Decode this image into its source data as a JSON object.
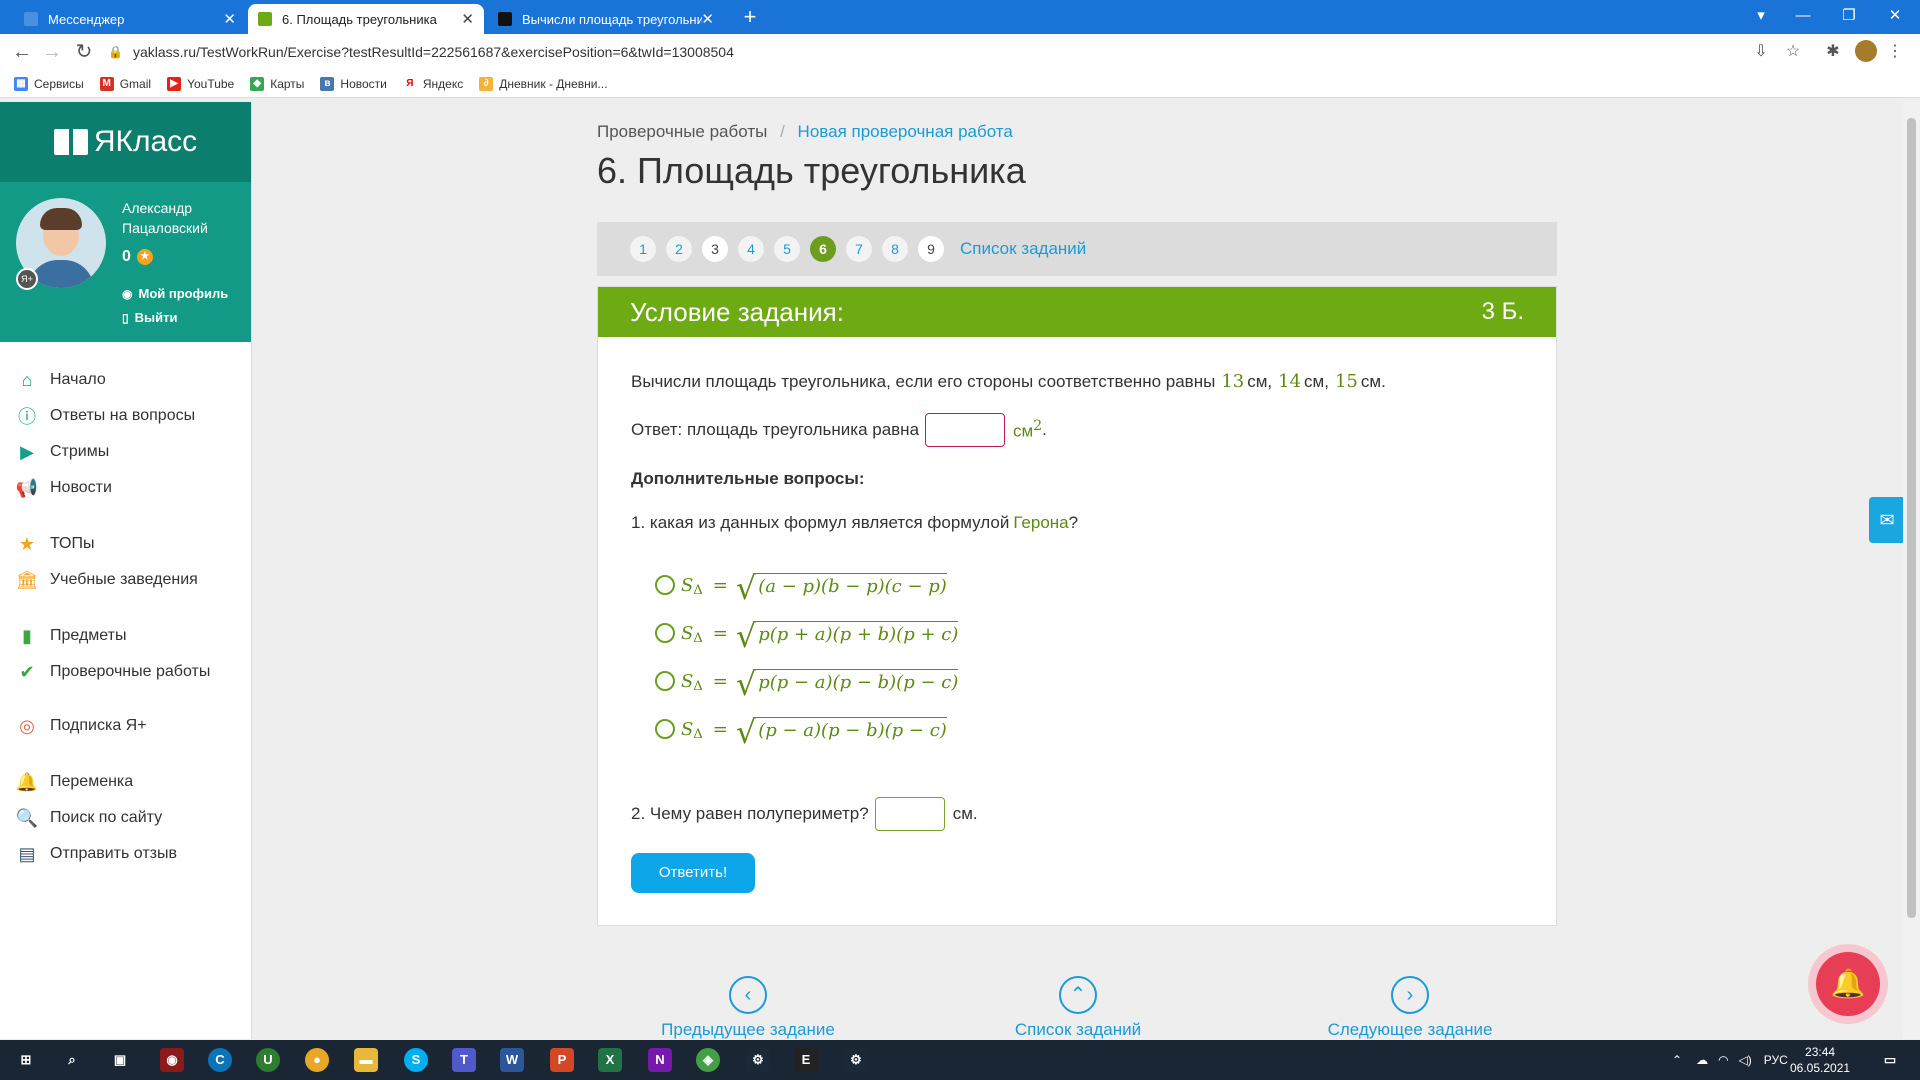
{
  "browser": {
    "tabs": [
      {
        "title": "Мессенджер",
        "close": "✕"
      },
      {
        "title": "6. Площадь треугольника",
        "close": "✕"
      },
      {
        "title": "Вычисли площадь треугольни…",
        "close": "✕"
      }
    ],
    "new_tab": "+",
    "url": "yaklass.ru/TestWorkRun/Exercise?testResultId=222561687&exercisePosition=6&twId=13008504",
    "bookmarks": [
      "Сервисы",
      "Gmail",
      "YouTube",
      "Карты",
      "Новости",
      "Яндекс",
      "Дневник - Дневни..."
    ]
  },
  "sidebar": {
    "logo": "ЯКласс",
    "user_name_line1": "Александр",
    "user_name_line2": "Пацаловский",
    "score": "0",
    "profile_link": "Мой профиль",
    "logout_link": "Выйти",
    "menu": [
      {
        "label": "Начало",
        "icon": "home-icon"
      },
      {
        "label": "Ответы на вопросы",
        "icon": "question-icon"
      },
      {
        "label": "Стримы",
        "icon": "play-icon"
      },
      {
        "label": "Новости",
        "icon": "megaphone-icon"
      },
      {
        "label": "ТОПы",
        "icon": "star-icon"
      },
      {
        "label": "Учебные заведения",
        "icon": "school-icon"
      },
      {
        "label": "Предметы",
        "icon": "books-icon"
      },
      {
        "label": "Проверочные работы",
        "icon": "check-icon"
      },
      {
        "label": "Подписка Я+",
        "icon": "yaplus-icon"
      },
      {
        "label": "Переменка",
        "icon": "bell-icon"
      },
      {
        "label": "Поиск по сайту",
        "icon": "search-icon"
      },
      {
        "label": "Отправить отзыв",
        "icon": "comment-icon"
      }
    ]
  },
  "breadcrumb": {
    "root": "Проверочные работы",
    "separator": "/",
    "current": "Новая проверочная работа"
  },
  "page_title": "6. Площадь треугольника",
  "pager": {
    "pages": [
      "1",
      "2",
      "3",
      "4",
      "5",
      "6",
      "7",
      "8",
      "9"
    ],
    "current": 6,
    "task_list": "Список заданий"
  },
  "task": {
    "header": "Условие задания:",
    "points": "3 Б.",
    "statement_prefix": "Вычисли площадь треугольника, если его стороны соответственно равны",
    "side_a": "13",
    "side_b": "14",
    "side_c": "15",
    "unit_cm": "см",
    "comma": ",",
    "period": ".",
    "answer_label": "Ответ: площадь треугольника равна",
    "answer_unit": "см",
    "answer_unit_power": "2",
    "extra_title": "Дополнительные вопросы:",
    "q1_prefix": "1. какая из данных формул является формулой",
    "q1_name": "Герона",
    "q1_suffix": "?",
    "formula_lhs": "S",
    "formula_sub": "Δ",
    "formula_eq": "=",
    "formula_rad": "√",
    "options": [
      "(a − p)(b − p)(c − p)",
      "p(p + a)(p + b)(p + c)",
      "p(p − a)(p − b)(p − c)",
      "(p − a)(p − b)(p − c)"
    ],
    "q2_label": "2. Чему равен полупериметр?",
    "q2_unit": "см.",
    "submit": "Ответить!"
  },
  "bottom_nav": {
    "prev": "Предыдущее задание",
    "list": "Список заданий",
    "next": "Следующее задание"
  },
  "taskbar": {
    "lang": "РУС",
    "time": "23:44",
    "date": "06.05.2021"
  }
}
